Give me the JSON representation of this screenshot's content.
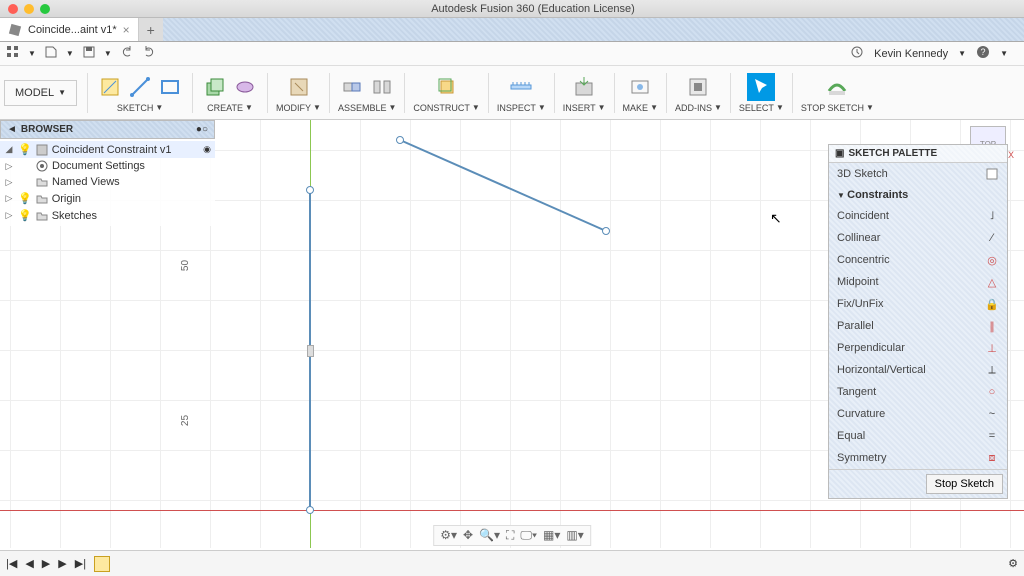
{
  "app": {
    "title": "Autodesk Fusion 360 (Education License)"
  },
  "tab": {
    "name": "Coincide...aint v1*"
  },
  "user": {
    "name": "Kevin Kennedy"
  },
  "ribbon": {
    "model": "MODEL",
    "groups": [
      "SKETCH",
      "CREATE",
      "MODIFY",
      "ASSEMBLE",
      "CONSTRUCT",
      "INSPECT",
      "INSERT",
      "MAKE",
      "ADD-INS",
      "SELECT",
      "STOP SKETCH"
    ]
  },
  "browser": {
    "header": "BROWSER",
    "root": "Coincident Constraint v1",
    "items": [
      "Document Settings",
      "Named Views",
      "Origin",
      "Sketches"
    ]
  },
  "dims": {
    "d1": "50",
    "d2": "25"
  },
  "viewcube": {
    "face": "TOP"
  },
  "palette": {
    "title": "SKETCH PALETTE",
    "sketch3d": "3D Sketch",
    "section": "Constraints",
    "items": [
      {
        "label": "Coincident",
        "sym": "˩"
      },
      {
        "label": "Collinear",
        "sym": "⁄"
      },
      {
        "label": "Concentric",
        "sym": "◎",
        "color": "#d05050"
      },
      {
        "label": "Midpoint",
        "sym": "△",
        "color": "#d05050"
      },
      {
        "label": "Fix/UnFix",
        "sym": "🔒",
        "color": "#d05050"
      },
      {
        "label": "Parallel",
        "sym": "∥",
        "color": "#d05050"
      },
      {
        "label": "Perpendicular",
        "sym": "⊥",
        "color": "#d05050"
      },
      {
        "label": "Horizontal/Vertical",
        "sym": "⟂"
      },
      {
        "label": "Tangent",
        "sym": "○",
        "color": "#d05050"
      },
      {
        "label": "Curvature",
        "sym": "~"
      },
      {
        "label": "Equal",
        "sym": "="
      },
      {
        "label": "Symmetry",
        "sym": "⧈",
        "color": "#d05050"
      }
    ],
    "stop": "Stop Sketch"
  }
}
